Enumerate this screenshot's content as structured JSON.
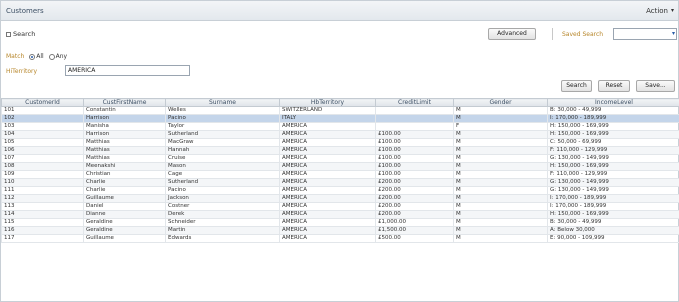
{
  "window": {
    "title": "Customers",
    "actions_label": "Action",
    "actions_caret": "▾"
  },
  "search": {
    "toggle_label": "Search",
    "advanced_label": "Advanced",
    "saved_search_label": "Saved Search",
    "saved_search_value": "",
    "saved_search_caret": "▾",
    "match_label": "Match",
    "match_all": "All",
    "match_any": "Any",
    "match_selected": "All",
    "territory_label": "HiTerritory",
    "territory_value": "AMERICA",
    "search_button": "Search",
    "reset_button": "Reset",
    "save_button": "Save..."
  },
  "table": {
    "columns": [
      "CustomerId",
      "CustFirstName",
      "Surname",
      "HbTerritory",
      "CreditLimit",
      "Gender",
      "IncomeLevel"
    ],
    "selected_row": 1,
    "rows": [
      [
        "101",
        "Constantin",
        "Welles",
        "SWITZERLAND",
        "",
        "M",
        "B: 30,000 - 49,999"
      ],
      [
        "102",
        "Harrison",
        "Pacino",
        "ITALY",
        "",
        "M",
        "I: 170,000 - 189,999"
      ],
      [
        "103",
        "Manisha",
        "Taylor",
        "AMERICA",
        "",
        "F",
        "H: 150,000 - 169,999"
      ],
      [
        "104",
        "Harrison",
        "Sutherland",
        "AMERICA",
        "£100.00",
        "M",
        "H: 150,000 - 169,999"
      ],
      [
        "105",
        "Matthias",
        "MacGraw",
        "AMERICA",
        "£100.00",
        "M",
        "C: 50,000 - 69,999"
      ],
      [
        "106",
        "Matthias",
        "Hannah",
        "AMERICA",
        "£100.00",
        "M",
        "F: 110,000 - 129,999"
      ],
      [
        "107",
        "Matthias",
        "Cruise",
        "AMERICA",
        "£100.00",
        "M",
        "G: 130,000 - 149,999"
      ],
      [
        "108",
        "Meenakshi",
        "Mason",
        "AMERICA",
        "£100.00",
        "M",
        "H: 150,000 - 169,999"
      ],
      [
        "109",
        "Christian",
        "Cage",
        "AMERICA",
        "£100.00",
        "M",
        "F: 110,000 - 129,999"
      ],
      [
        "110",
        "Charlie",
        "Sutherland",
        "AMERICA",
        "£200.00",
        "M",
        "G: 130,000 - 149,999"
      ],
      [
        "111",
        "Charlie",
        "Pacino",
        "AMERICA",
        "£200.00",
        "M",
        "G: 130,000 - 149,999"
      ],
      [
        "112",
        "Guillaume",
        "Jackson",
        "AMERICA",
        "£200.00",
        "M",
        "I: 170,000 - 189,999"
      ],
      [
        "113",
        "Daniel",
        "Costner",
        "AMERICA",
        "£200.00",
        "M",
        "I: 170,000 - 189,999"
      ],
      [
        "114",
        "Dianne",
        "Derek",
        "AMERICA",
        "£200.00",
        "M",
        "H: 150,000 - 169,999"
      ],
      [
        "115",
        "Geraldine",
        "Schneider",
        "AMERICA",
        "£1,000.00",
        "M",
        "B: 30,000 - 49,999"
      ],
      [
        "116",
        "Geraldine",
        "Martin",
        "AMERICA",
        "£1,500.00",
        "M",
        "A: Below 30,000"
      ],
      [
        "117",
        "Guillaume",
        "Edwards",
        "AMERICA",
        "£500.00",
        "M",
        "E: 90,000 - 109,999"
      ]
    ]
  }
}
